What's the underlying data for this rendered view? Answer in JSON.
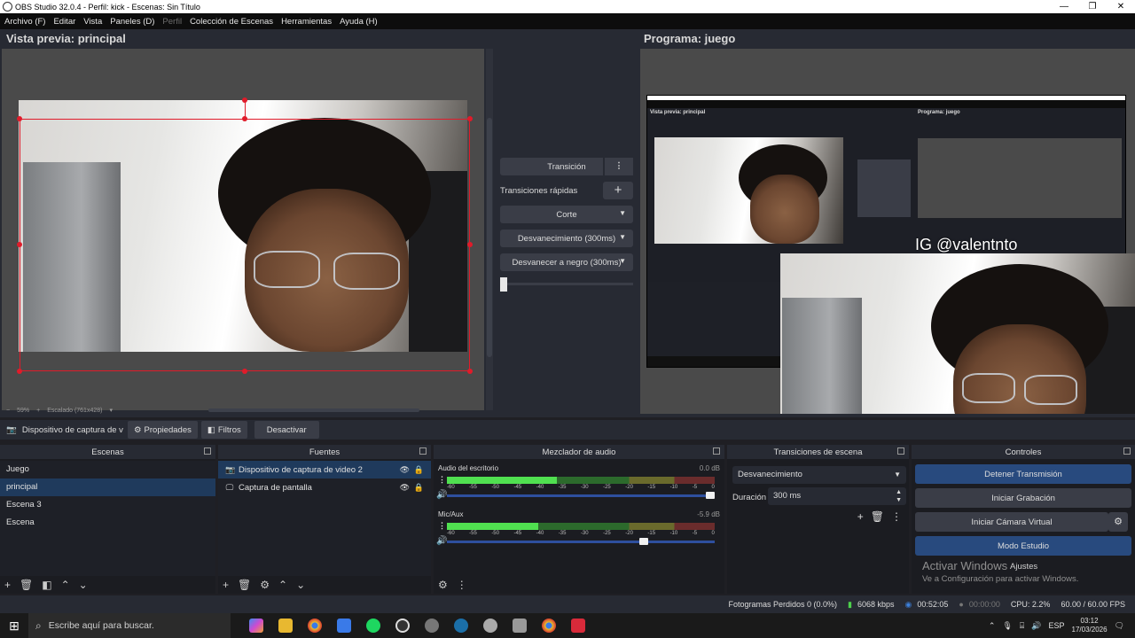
{
  "window": {
    "title": "OBS Studio 32.0.4 - Perfil: kick - Escenas: Sin Título",
    "minimize": "—",
    "maximize": "❐",
    "close": "✕"
  },
  "menu": [
    "Archivo (F)",
    "Editar",
    "Vista",
    "Paneles (D)",
    "Perfil",
    "Colección de Escenas",
    "Herramientas",
    "Ayuda (H)"
  ],
  "preview": {
    "title": "Vista previa: principal",
    "zoom": "59%",
    "scale_info": "Escalado (761x428)"
  },
  "program": {
    "title": "Programa: juego",
    "overlay_text": "IG @valentnto",
    "overlay_text_small": "IG @valentnto"
  },
  "transition_panel": {
    "transition_label": "Transición",
    "quick_label": "Transiciones rápidas",
    "options": [
      "Corte",
      "Desvanecimiento (300ms)",
      "Desvanecer a negro (300ms)"
    ],
    "tbar_level": 0
  },
  "source_toolbar": {
    "selected_source": "Dispositivo de captura de v",
    "properties": "Propiedades",
    "filters": "Filtros",
    "deactivate": "Desactivar"
  },
  "scenes": {
    "title": "Escenas",
    "items": [
      "Juego",
      "principal",
      "Escena 3",
      "Escena"
    ],
    "selected": "principal"
  },
  "sources": {
    "title": "Fuentes",
    "items": [
      "Dispositivo de captura de video 2",
      "Captura de pantalla"
    ]
  },
  "mixer": {
    "title": "Mezclador de audio",
    "channels": [
      {
        "name": "Audio del escritorio",
        "db": "0.0 dB",
        "level": 0.41,
        "volume": 1.0
      },
      {
        "name": "Mic/Aux",
        "db": "-5.9 dB",
        "level": 0.34,
        "volume": 0.75
      }
    ],
    "scale": [
      "-60",
      "-55",
      "-50",
      "-45",
      "-40",
      "-35",
      "-30",
      "-25",
      "-20",
      "-15",
      "-10",
      "-5",
      "0"
    ]
  },
  "scene_transitions": {
    "title": "Transiciones de escena",
    "type": "Desvanecimiento",
    "duration_label": "Duración",
    "duration": "300 ms"
  },
  "controls": {
    "title": "Controles",
    "stop_stream": "Detener Transmisión",
    "start_recording": "Iniciar Grabación",
    "virtual_cam": "Iniciar Cámara Virtual",
    "studio_mode": "Modo Estudio",
    "settings": "Ajustes",
    "activate_windows": "Activar Windows",
    "activate_windows_sub": "Ve a Configuración para activar Windows."
  },
  "status": {
    "dropped": "Fotogramas Perdidos 0 (0.0%)",
    "bitrate": "6068 kbps",
    "stream_time": "00:52:05",
    "rec_time": "00:00:00",
    "cpu": "CPU: 2.2%",
    "fps": "60.00 / 60.00 FPS"
  },
  "taskbar": {
    "search_placeholder": "Escribe aquí para buscar.",
    "lang": "ESP",
    "time": "03:12",
    "date": "17/03/2026"
  },
  "colors": {
    "accent": "#284a7e",
    "selection": "#1f3a5c",
    "bounding_box": "#e01b2a"
  }
}
